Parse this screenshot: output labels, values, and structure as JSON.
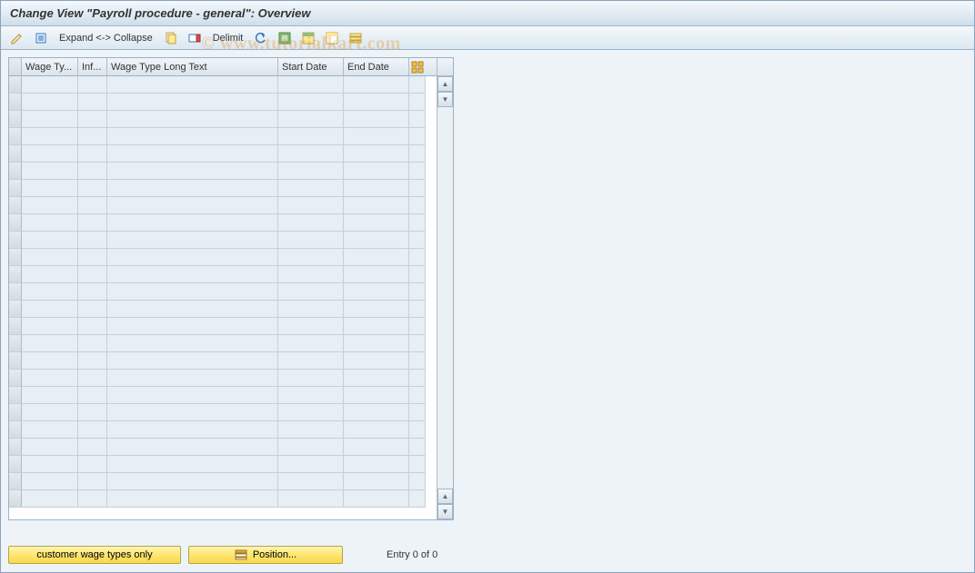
{
  "title": "Change View \"Payroll procedure - general\": Overview",
  "toolbar": {
    "expand_collapse": "Expand <-> Collapse",
    "delimit": "Delimit"
  },
  "table": {
    "columns": {
      "wage_type": "Wage Ty...",
      "inf": "Inf...",
      "wage_long": "Wage Type Long Text",
      "start_date": "Start Date",
      "end_date": "End Date"
    },
    "rows": 25
  },
  "footer": {
    "customer_btn": "customer wage types only",
    "position_btn": "Position...",
    "entry_text": "Entry 0 of 0"
  },
  "watermark": "© www.tutorialkart.com"
}
